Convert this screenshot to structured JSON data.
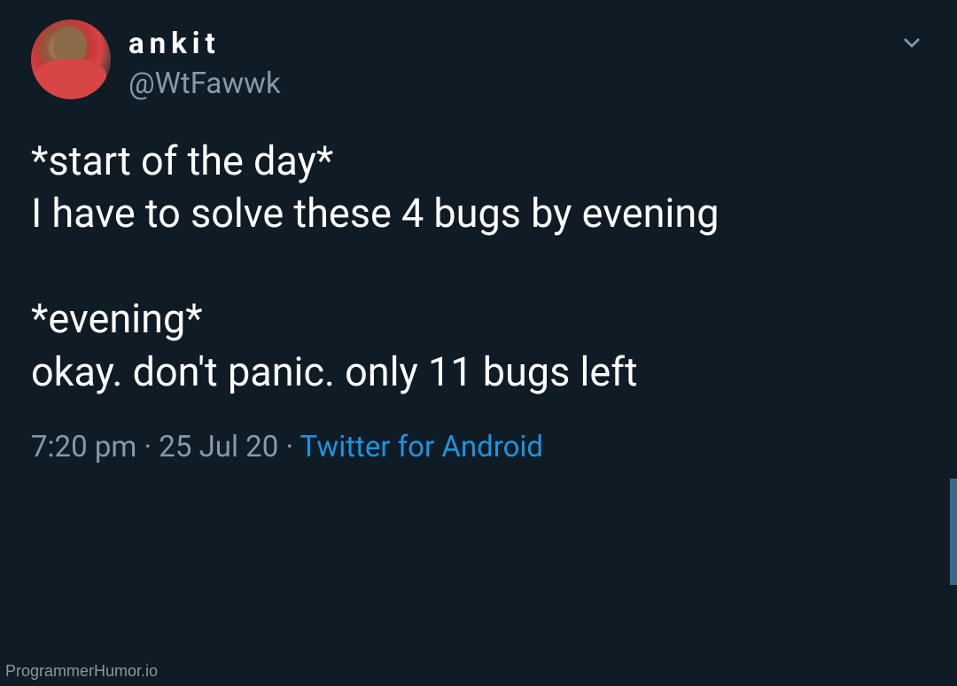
{
  "tweet": {
    "user": {
      "display_name": "ankit",
      "handle": "@WtFawwk"
    },
    "body": "*start of the day*\nI have to solve these 4 bugs by evening\n\n*evening*\nokay. don't panic. only 11 bugs left",
    "meta": {
      "time": "7:20 pm",
      "date": "25 Jul 20",
      "source": "Twitter for Android",
      "separator": " · "
    }
  },
  "watermark": "ProgrammerHumor.io"
}
